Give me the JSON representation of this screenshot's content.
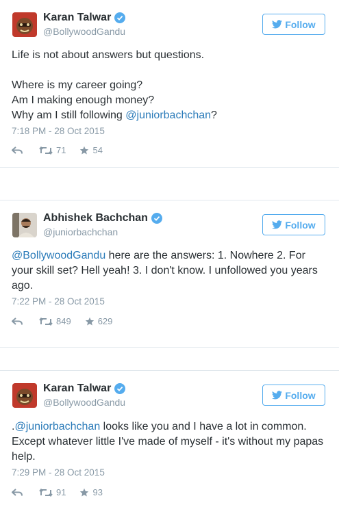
{
  "tweets": [
    {
      "name": "Karan Talwar",
      "handle": "@BollywoodGandu",
      "follow_label": "Follow",
      "text_parts": [
        {
          "t": "Life is not about answers but questions.\n\nWhere is my career going?\nAm I making enough money?\nWhy am I still following "
        },
        {
          "t": "@juniorbachchan",
          "mention": true
        },
        {
          "t": "?"
        }
      ],
      "timestamp": "7:18 PM - 28 Oct 2015",
      "retweets": "71",
      "likes": "54",
      "avatar": "cartoon-avatar"
    },
    {
      "name": "Abhishek Bachchan",
      "handle": "@juniorbachchan",
      "follow_label": "Follow",
      "text_parts": [
        {
          "t": "@BollywoodGandu",
          "mention": true
        },
        {
          "t": " here are the answers: 1. Nowhere 2. For your skill set? Hell yeah! 3. I don't know. I unfollowed you years ago."
        }
      ],
      "timestamp": "7:22 PM - 28 Oct 2015",
      "retweets": "849",
      "likes": "629",
      "avatar": "photo-avatar"
    },
    {
      "name": "Karan Talwar",
      "handle": "@BollywoodGandu",
      "follow_label": "Follow",
      "text_parts": [
        {
          "t": "."
        },
        {
          "t": "@juniorbachchan",
          "mention": true
        },
        {
          "t": " looks like you and I have a lot in common. Except whatever little I've made of myself - it's without my papas help."
        }
      ],
      "timestamp": "7:29 PM - 28 Oct 2015",
      "retweets": "91",
      "likes": "93",
      "avatar": "cartoon-avatar"
    }
  ],
  "colors": {
    "accent": "#55acee",
    "mention": "#2b7bb9",
    "muted": "#8899a6",
    "text": "#292f33"
  }
}
